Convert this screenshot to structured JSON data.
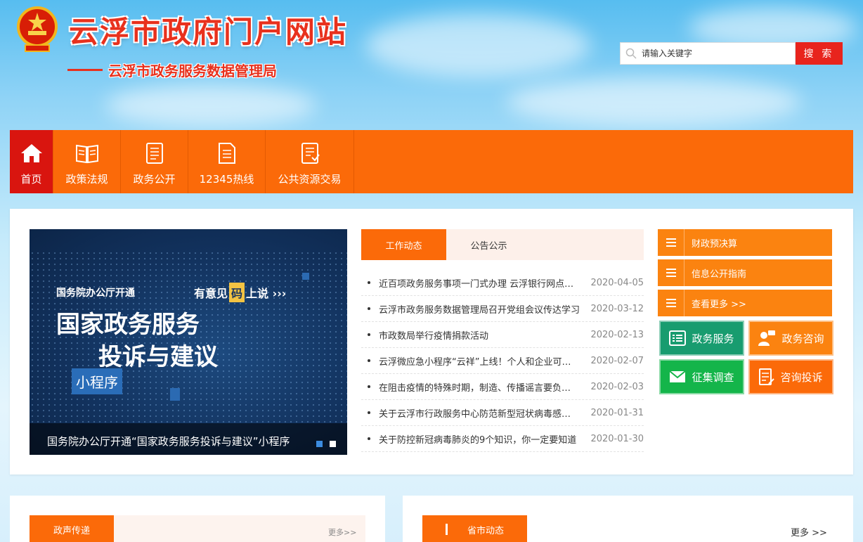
{
  "header": {
    "site_title": "云浮市政府门户网站",
    "sub_title": "云浮市政务服务数据管理局",
    "search_placeholder": "请输入关键字",
    "search_button": "搜 索"
  },
  "nav": {
    "items": [
      {
        "label": "首页",
        "icon": "home-icon"
      },
      {
        "label": "政策法规",
        "icon": "book-icon"
      },
      {
        "label": "政务公开",
        "icon": "document-icon"
      },
      {
        "label": "12345热线",
        "icon": "hotline-doc-icon"
      },
      {
        "label": "公共资源交易",
        "icon": "trade-doc-icon"
      }
    ]
  },
  "banner": {
    "small_text": "国务院办公厅开通",
    "right_text_a": "有意见",
    "right_text_ma": "码",
    "right_text_b": "上说 ›››",
    "big_line1": "国家政务服务",
    "big_line2": "投诉与建议",
    "mini_label": "小程序",
    "caption": "国务院办公厅开通“国家政务服务投诉与建议”小程序"
  },
  "news": {
    "tabs": [
      "工作动态",
      "公告公示"
    ],
    "items": [
      {
        "title": "近百项政务服务事项一门式办理 云浮银行网点可办理",
        "date": "2020-04-05"
      },
      {
        "title": "云浮市政务服务数据管理局召开党组会议传达学习",
        "date": "2020-03-12"
      },
      {
        "title": "市政数局举行疫情捐款活动",
        "date": "2020-02-13"
      },
      {
        "title": "云浮微应急小程序“云祥”上线！个人和企业可通过",
        "date": "2020-02-07"
      },
      {
        "title": "在阻击疫情的特殊时期，制造、传播谣言要负法律责任",
        "date": "2020-02-03"
      },
      {
        "title": "关于云浮市行政服务中心防范新型冠状病毒感染的通告",
        "date": "2020-01-31"
      },
      {
        "title": "关于防控新冠病毒肺炎的9个知识，你一定要知道",
        "date": "2020-01-30"
      }
    ]
  },
  "side": {
    "links": [
      "财政预决算",
      "信息公开指南",
      "查看更多 >>"
    ],
    "services": [
      {
        "label": "政务服务",
        "color": "#189c6f"
      },
      {
        "label": "政务咨询",
        "color": "#fb8310"
      },
      {
        "label": "征集调查",
        "color": "#14b54a"
      },
      {
        "label": "咨询投诉",
        "color": "#fb6a09"
      }
    ]
  },
  "bottom": {
    "left_tab": "政声传递",
    "left_more": "更多>>",
    "right_tab": "省市动态",
    "right_more": "更多 >>"
  },
  "colors": {
    "primary_orange": "#fb6a09",
    "active_red": "#d9150f",
    "title_red": "#e8311d",
    "search_red": "#e8241d"
  }
}
